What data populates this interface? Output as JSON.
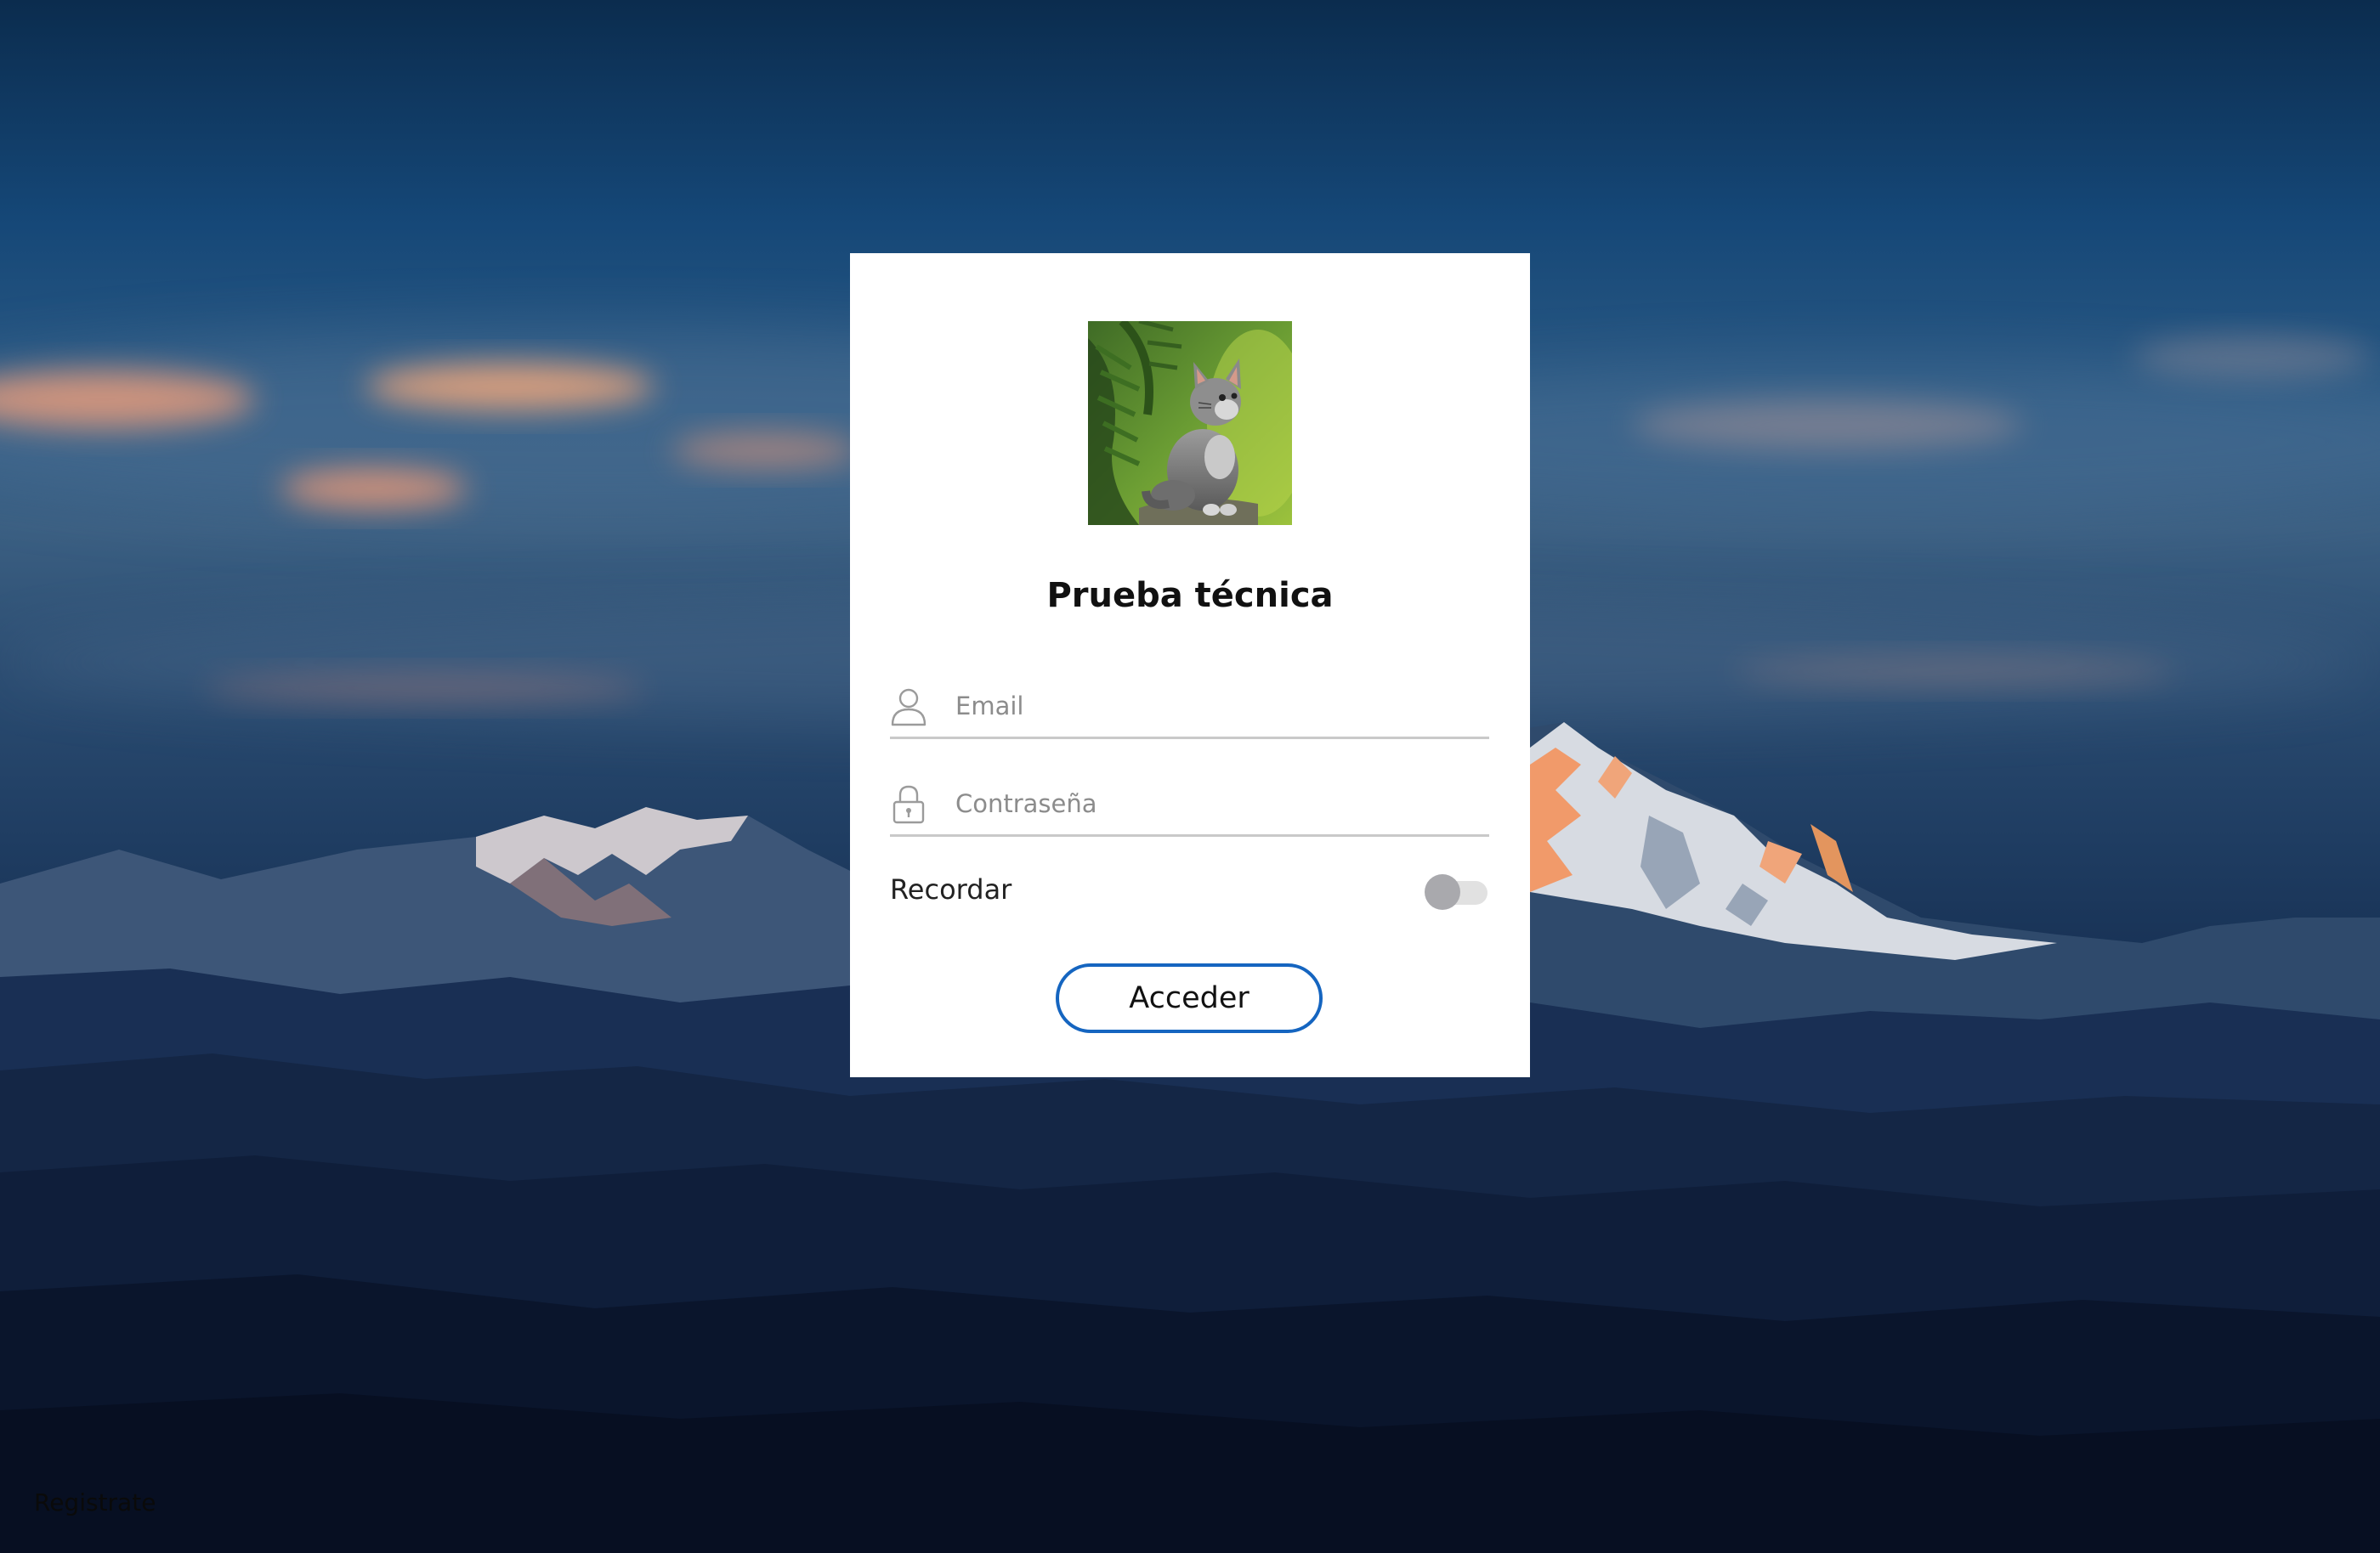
{
  "login_card": {
    "title": "Prueba técnica",
    "avatar_icon": "kitten-photo",
    "email_field": {
      "placeholder": "Email",
      "value": "",
      "icon": "user-icon"
    },
    "password_field": {
      "placeholder": "Contraseña",
      "value": "",
      "icon": "lock-icon"
    },
    "remember": {
      "label": "Recordar",
      "checked": false
    },
    "submit_label": "Acceder"
  },
  "footer": {
    "register_link": "Registrate"
  },
  "colors": {
    "button_border": "#1565c0",
    "card_background": "#ffffff",
    "toggle_knob": "#a9a9ad",
    "toggle_track": "#e1e1e1"
  }
}
